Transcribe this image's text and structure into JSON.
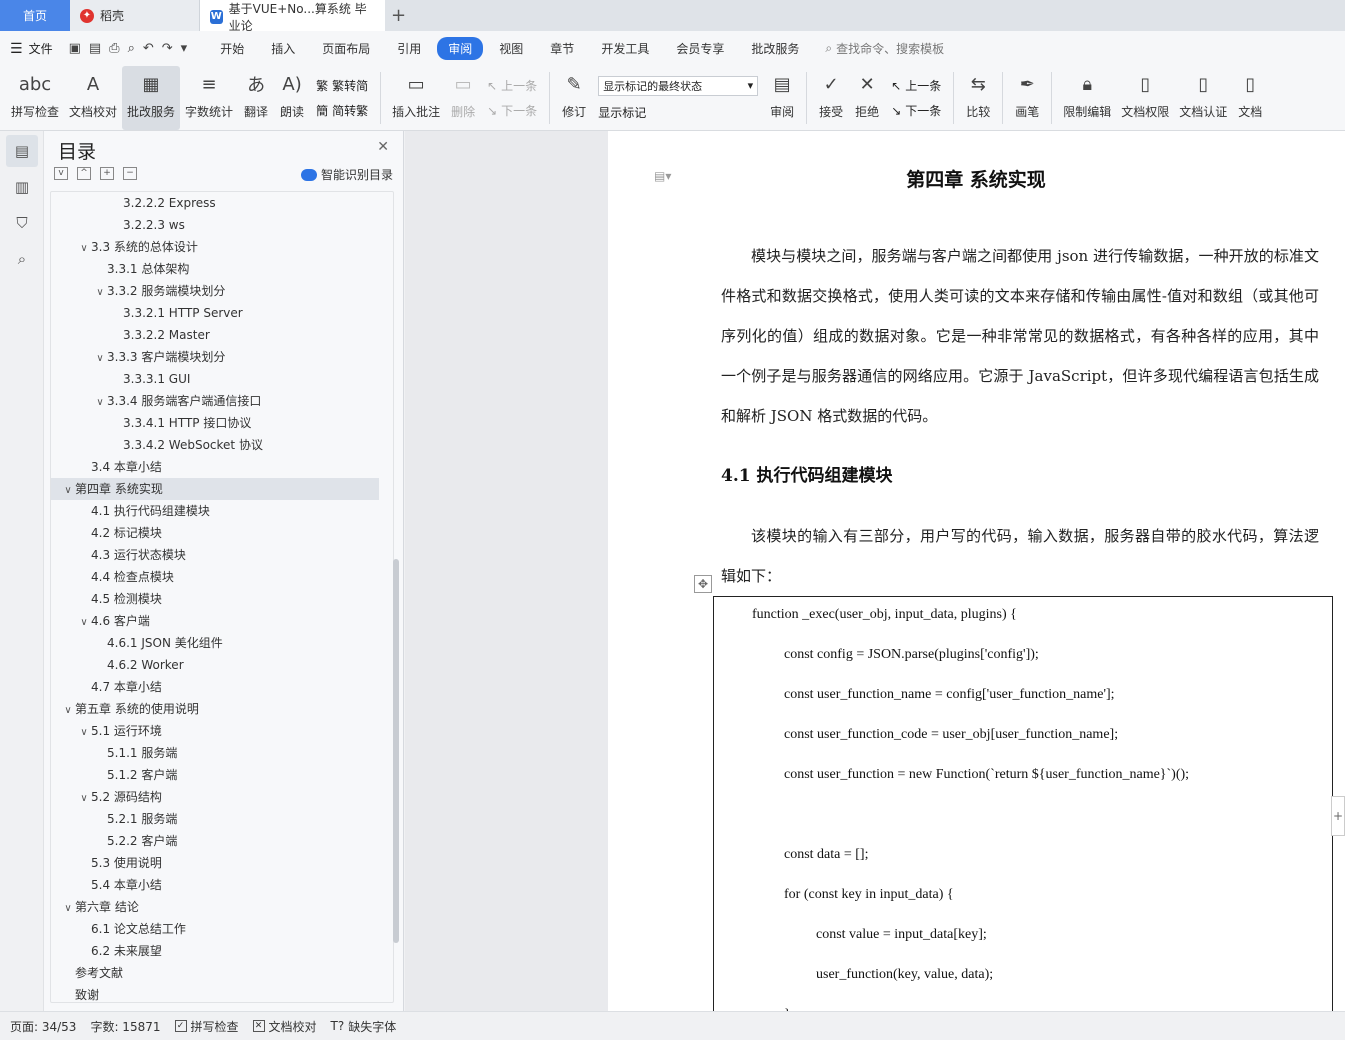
{
  "tabs": {
    "home": "首页",
    "daoke": "稻壳",
    "doc": "基于VUE+No...算系统 毕业论",
    "add": "+"
  },
  "menu": {
    "file": "文件",
    "items": [
      "开始",
      "插入",
      "页面布局",
      "引用",
      "审阅",
      "视图",
      "章节",
      "开发工具",
      "会员专享",
      "批改服务"
    ],
    "active_index": 4,
    "search": "查找命令、搜索模板"
  },
  "ribbon": {
    "spell": "拼写检查",
    "proof": "文档校对",
    "grading": "批改服务",
    "wordcount": "字数统计",
    "translate": "翻译",
    "read": "朗读",
    "to_trad": "繁转简",
    "to_simp": "简转繁",
    "insert_comment": "插入批注",
    "delete": "删除",
    "prev": "上一条",
    "next": "下一条",
    "revise": "修订",
    "markup_state": "显示标记的最终状态",
    "show_markup": "显示标记",
    "review": "审阅",
    "accept": "接受",
    "reject": "拒绝",
    "prev2": "上一条",
    "next2": "下一条",
    "compare": "比较",
    "pen": "画笔",
    "restrict": "限制编辑",
    "doc_perm": "文档权限",
    "doc_cert": "文档认证",
    "doc_more": "文档"
  },
  "toc": {
    "title": "目录",
    "smart": "智能识别目录",
    "items": [
      {
        "text": "3.2.2.2  Express",
        "level": 4,
        "arrow": ""
      },
      {
        "text": "3.2.2.3  ws",
        "level": 4,
        "arrow": ""
      },
      {
        "text": "3.3  系统的总体设计",
        "level": 2,
        "arrow": "v"
      },
      {
        "text": "3.3.1  总体架构",
        "level": 3,
        "arrow": ""
      },
      {
        "text": "3.3.2  服务端模块划分",
        "level": 3,
        "arrow": "v"
      },
      {
        "text": "3.3.2.1  HTTP Server",
        "level": 4,
        "arrow": ""
      },
      {
        "text": "3.3.2.2  Master",
        "level": 4,
        "arrow": ""
      },
      {
        "text": "3.3.3  客户端模块划分",
        "level": 3,
        "arrow": "v"
      },
      {
        "text": "3.3.3.1  GUI",
        "level": 4,
        "arrow": ""
      },
      {
        "text": "3.3.4  服务端客户端通信接口",
        "level": 3,
        "arrow": "v"
      },
      {
        "text": "3.3.4.1  HTTP 接口协议",
        "level": 4,
        "arrow": ""
      },
      {
        "text": "3.3.4.2  WebSocket 协议",
        "level": 4,
        "arrow": ""
      },
      {
        "text": "3.4  本章小结",
        "level": 2,
        "arrow": ""
      },
      {
        "text": "第四章  系统实现",
        "level": 1,
        "arrow": "v",
        "active": true
      },
      {
        "text": "4.1  执行代码组建模块",
        "level": 2,
        "arrow": ""
      },
      {
        "text": "4.2  标记模块",
        "level": 2,
        "arrow": ""
      },
      {
        "text": "4.3  运行状态模块",
        "level": 2,
        "arrow": ""
      },
      {
        "text": "4.4  检查点模块",
        "level": 2,
        "arrow": ""
      },
      {
        "text": "4.5  检测模块",
        "level": 2,
        "arrow": ""
      },
      {
        "text": "4.6  客户端",
        "level": 2,
        "arrow": "v"
      },
      {
        "text": "4.6.1  JSON 美化组件",
        "level": 3,
        "arrow": ""
      },
      {
        "text": "4.6.2  Worker",
        "level": 3,
        "arrow": ""
      },
      {
        "text": "4.7  本章小结",
        "level": 2,
        "arrow": ""
      },
      {
        "text": "第五章  系统的使用说明",
        "level": 1,
        "arrow": "v"
      },
      {
        "text": "5.1  运行环境",
        "level": 2,
        "arrow": "v"
      },
      {
        "text": "5.1.1  服务端",
        "level": 3,
        "arrow": ""
      },
      {
        "text": "5.1.2  客户端",
        "level": 3,
        "arrow": ""
      },
      {
        "text": "5.2  源码结构",
        "level": 2,
        "arrow": "v"
      },
      {
        "text": "5.2.1  服务端",
        "level": 3,
        "arrow": ""
      },
      {
        "text": "5.2.2  客户端",
        "level": 3,
        "arrow": ""
      },
      {
        "text": "5.3  使用说明",
        "level": 2,
        "arrow": ""
      },
      {
        "text": "5.4  本章小结",
        "level": 2,
        "arrow": ""
      },
      {
        "text": "第六章  结论",
        "level": 1,
        "arrow": "v"
      },
      {
        "text": "6.1  论文总结工作",
        "level": 2,
        "arrow": ""
      },
      {
        "text": "6.2  未来展望",
        "level": 2,
        "arrow": ""
      },
      {
        "text": "参考文献",
        "level": 1,
        "arrow": ""
      },
      {
        "text": "致谢",
        "level": 1,
        "arrow": ""
      }
    ]
  },
  "doc": {
    "chapter": "第四章  系统实现",
    "para1": "模块与模块之间，服务端与客户端之间都使用 json 进行传输数据，一种开放的标准文件格式和数据交换格式，使用人类可读的文本来存储和传输由属性-值对和数组（或其他可序列化的值）组成的数据对象。它是一种非常常见的数据格式，有各种各样的应用，其中一个例子是与服务器通信的网络应用。它源于 JavaScript，但许多现代编程语言包括生成和解析 JSON 格式数据的代码。",
    "heading": "4.1  执行代码组建模块",
    "para2": "该模块的输入有三部分，用户写的代码，输入数据，服务器自带的胶水代码，算法逻辑如下：",
    "code": [
      "function _exec(user_obj, input_data, plugins) {",
      "const config = JSON.parse(plugins['config']);",
      "const user_function_name = config['user_function_name'];",
      "const user_function_code = user_obj[user_function_name];",
      "const user_function = new Function(`return ${user_function_name}`)();",
      "",
      "const data = [];",
      "for (const key in input_data) {",
      "const value = input_data[key];",
      "user_function(key, value, data);",
      "}"
    ]
  },
  "status": {
    "page": "页面: 34/53",
    "words": "字数: 15871",
    "spell": "拼写检查",
    "proof": "文档校对",
    "missing_font": "缺失字体"
  }
}
